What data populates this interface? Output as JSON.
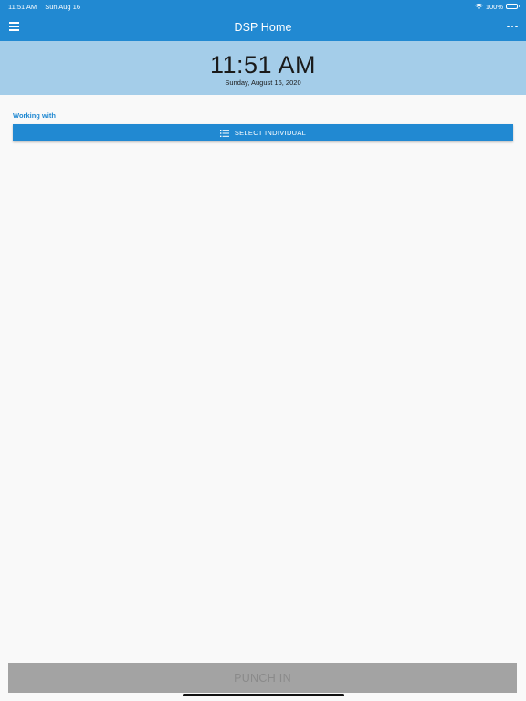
{
  "status_bar": {
    "time": "11:51 AM",
    "date": "Sun Aug 16",
    "battery": "100%"
  },
  "nav": {
    "title": "DSP Home",
    "menu_icon": "hamburger-icon",
    "more_icon": "more-horizontal-icon"
  },
  "clock": {
    "time": "11:51 AM",
    "date": "Sunday, August 16, 2020"
  },
  "working_with": {
    "label": "Working with",
    "button_label": "SELECT INDIVIDUAL",
    "button_icon": "list-icon"
  },
  "footer": {
    "punch_label": "PUNCH IN"
  },
  "colors": {
    "primary": "#2189d2",
    "clock_bg": "#a4cde9",
    "punch_disabled_bg": "#a3a3a3"
  }
}
